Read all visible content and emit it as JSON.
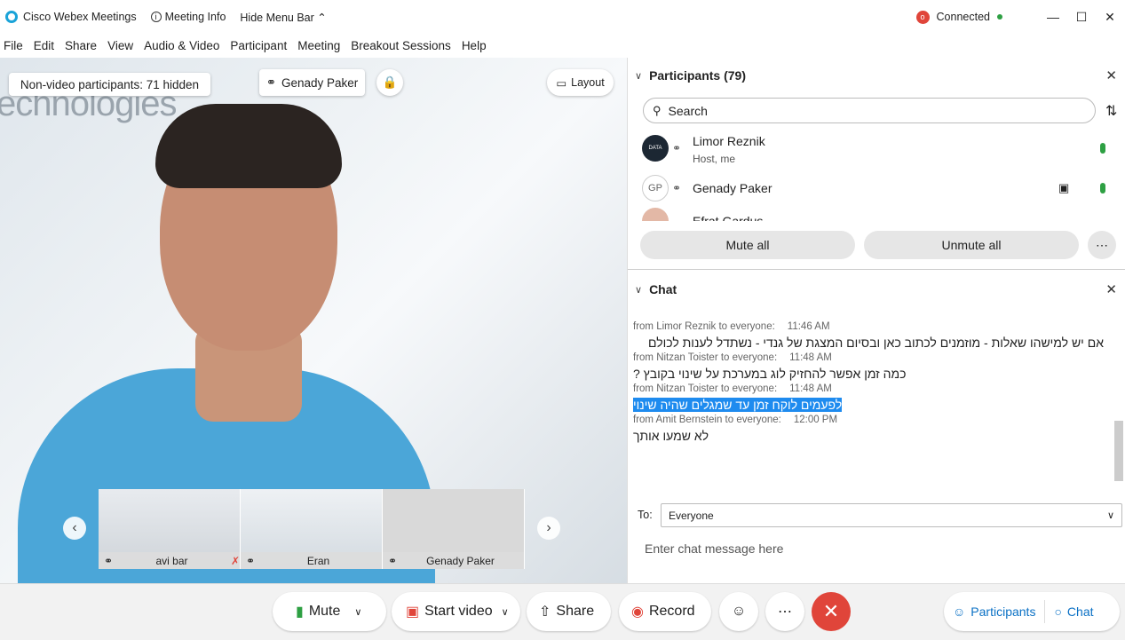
{
  "titlebar": {
    "app_name": "Cisco Webex Meetings",
    "meeting_info": "Meeting Info",
    "hide_menu": "Hide Menu Bar",
    "status": "Connected"
  },
  "menu": [
    "File",
    "Edit",
    "Share",
    "View",
    "Audio & Video",
    "Participant",
    "Meeting",
    "Breakout Sessions",
    "Help"
  ],
  "video": {
    "background_brand": "echnologies",
    "non_video": "Non-video participants: 71 hidden",
    "active_speaker": "Genady Paker",
    "layout_label": "Layout",
    "thumbnails": [
      {
        "name": "avi bar"
      },
      {
        "name": "Eran"
      },
      {
        "name": "Genady Paker"
      }
    ]
  },
  "participants": {
    "header": "Participants (79)",
    "search_placeholder": "Search",
    "list": [
      {
        "name": "Limor Reznik",
        "sub": "Host, me"
      },
      {
        "name": "Genady Paker",
        "initials": "GP"
      },
      {
        "name": "Efrat Gardus"
      }
    ],
    "mute_all": "Mute all",
    "unmute_all": "Unmute all"
  },
  "chat": {
    "header": "Chat",
    "messages": [
      {
        "from": "from Limor Reznik to everyone:",
        "time": "11:46 AM",
        "text": "אם יש למישהו שאלות - מוזמנים לכתוב כאן ובסיום המצגת של גנדי - נשתדל לענות לכולם"
      },
      {
        "from": "from Nitzan Toister to everyone:",
        "time": "11:48 AM",
        "text": "כמה זמן אפשר להחזיק  לוג במערכת על שינוי בקובץ ?"
      },
      {
        "from": "from Nitzan Toister to everyone:",
        "time": "11:48 AM",
        "text": "לפעמים לוקח זמן עד שמגלים שהיה שינוי"
      },
      {
        "from": "from Amit Bernstein to everyone:",
        "time": "12:00 PM",
        "text": "לא שמעו אותך"
      }
    ],
    "to_label": "To:",
    "to_value": "Everyone",
    "input_placeholder": "Enter chat message here"
  },
  "controls": {
    "mute": "Mute",
    "start_video": "Start video",
    "share": "Share",
    "record": "Record",
    "participants": "Participants",
    "chat": "Chat"
  },
  "colors": {
    "accent": "#0b71c5",
    "end_call": "#e0453a",
    "highlight": "#1e8bef",
    "connected": "#2ea043"
  }
}
